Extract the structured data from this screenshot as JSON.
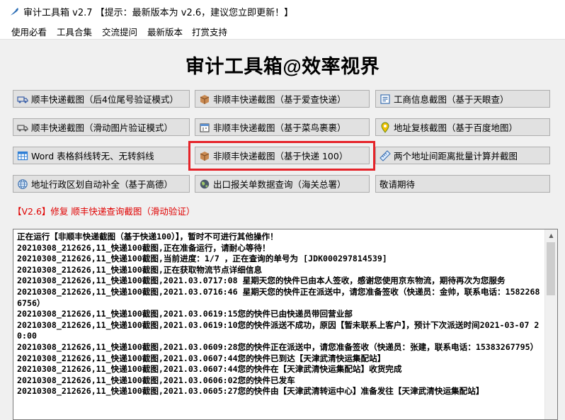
{
  "window": {
    "title": "审计工具箱 v2.7 【提示：最新版本为 v2.6，建议您立即更新！】"
  },
  "menu": {
    "items": [
      "使用必看",
      "工具合集",
      "交流提问",
      "最新版本",
      "打赏支持"
    ]
  },
  "heading": "审计工具箱@效率视界",
  "buttons": {
    "sf_tail": "顺丰快递截图（后4位尾号验证模式）",
    "non_sf_aicha": "非顺丰快递截图（基于爱查快递）",
    "business_info": "工商信息截图（基于天眼查）",
    "sf_slider": "顺丰快递截图（滑动图片验证模式）",
    "non_sf_cainiao": "非顺丰快递截图（基于菜鸟裹裹）",
    "address_verify": "地址复核截图（基于百度地图）",
    "word_diagonal": "Word 表格斜线转无、无转斜线",
    "non_sf_kuaidi100": "非顺丰快递截图（基于快递 100）",
    "distance_calc": "两个地址间距离批量计算并截图",
    "address_complete": "地址行政区划自动补全（基于高德）",
    "customs_query": "出口报关单数据查询（海关总署）",
    "coming_soon": "敬请期待"
  },
  "notice": "【V2.6】修复 顺丰快递查询截图（滑动验证）",
  "log": {
    "lines": [
      "正在运行【非顺丰快递截图（基于快递100）】，暂时不可进行其他操作！",
      "20210308_212626,11_快递100截图,正在准备运行，请耐心等待！",
      "20210308_212626,11_快递100截图,当前进度：1/7 ，正在查询的单号为 [JDK000297814539]",
      "20210308_212626,11_快递100截图,正在获取物流节点详细信息",
      "20210308_212626,11_快递100截图,2021.03.0717:08 星期天您的快件已由本人签收，感谢您使用京东物流，期待再次为您服务",
      "20210308_212626,11_快递100截图,2021.03.0716:46 星期天您的快件正在派送中，请您准备签收（快递员：金帅，联系电话：15822686756）",
      "20210308_212626,11_快递100截图,2021.03.0619:15您的快件已由快递员带回营业部",
      "20210308_212626,11_快递100截图,2021.03.0619:10您的快件派送不成功，原因【暂未联系上客户】，预计下次派送时间2021-03-07 20:00",
      "20210308_212626,11_快递100截图,2021.03.0609:28您的快件正在派送中，请您准备签收（快递员：张建，联系电话：15383267795）",
      "20210308_212626,11_快递100截图,2021.03.0607:44您的快件已到达【天津武清快运集配站】",
      "20210308_212626,11_快递100截图,2021.03.0607:44您的快件在【天津武清快运集配站】收货完成",
      "20210308_212626,11_快递100截图,2021.03.0606:02您的快件已发车",
      "20210308_212626,11_快递100截图,2021.03.0605:27您的快件由【天津武清转运中心】准备发往【天津武清快运集配站】"
    ]
  },
  "colors": {
    "highlight_border": "#e52329",
    "notice_text": "#e00000",
    "button_bg": "#e1e1e1"
  },
  "icons": {
    "app": "feather-icon",
    "sf_tail": "truck-icon",
    "non_sf_aicha": "package-box-icon",
    "business_info": "document-list-icon",
    "sf_slider": "truck-icon",
    "non_sf_cainiao": "calendar-icon",
    "address_verify": "map-pin-icon",
    "word_diagonal": "table-icon",
    "non_sf_kuaidi100": "package-box-icon",
    "distance_calc": "ruler-icon",
    "address_complete": "globe-icon",
    "customs_query": "globe-dark-icon"
  }
}
